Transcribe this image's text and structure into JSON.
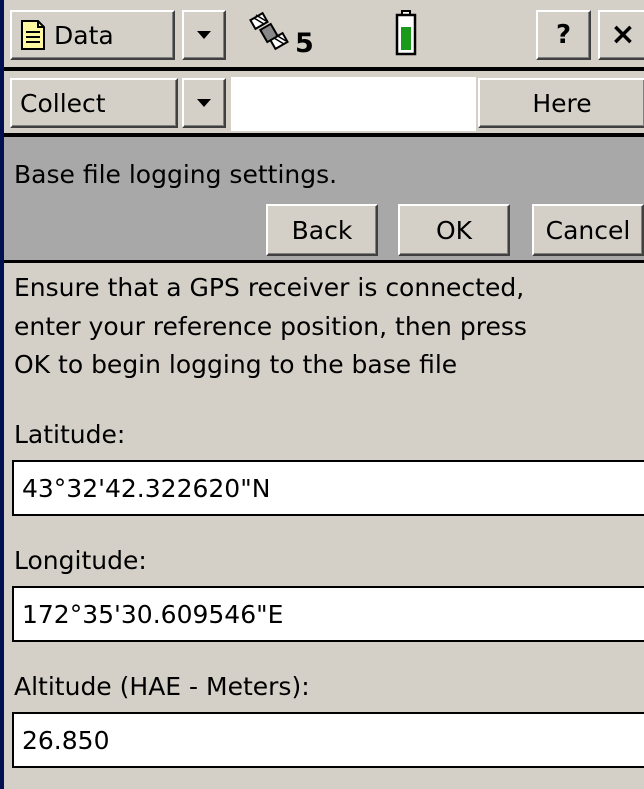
{
  "menu": {
    "data_label": "Data",
    "satellite_count": "5",
    "help_label": "?",
    "close_label": "×"
  },
  "toolbar": {
    "collect_label": "Collect",
    "here_label": "Here"
  },
  "dialog": {
    "title": "Base file logging settings.",
    "back_label": "Back",
    "ok_label": "OK",
    "cancel_label": "Cancel"
  },
  "content": {
    "instructions": [
      "Ensure that a GPS receiver is connected,",
      "enter your reference position, then press",
      "OK to begin logging to the base file"
    ],
    "latitude_label": "Latitude:",
    "latitude_value": "43°32'42.322620\"N",
    "longitude_label": "Longitude:",
    "longitude_value": "172°35'30.609546\"E",
    "altitude_label": "Altitude (HAE - Meters):",
    "altitude_value": "26.850"
  },
  "icons": {
    "document": "document-icon",
    "satellite": "satellite-icon",
    "battery": "battery-icon",
    "dropdown": "chevron-down-icon"
  },
  "colors": {
    "background": "#d4d0c8",
    "battery_fill": "#1a9a1a",
    "window_border": "#001050"
  }
}
